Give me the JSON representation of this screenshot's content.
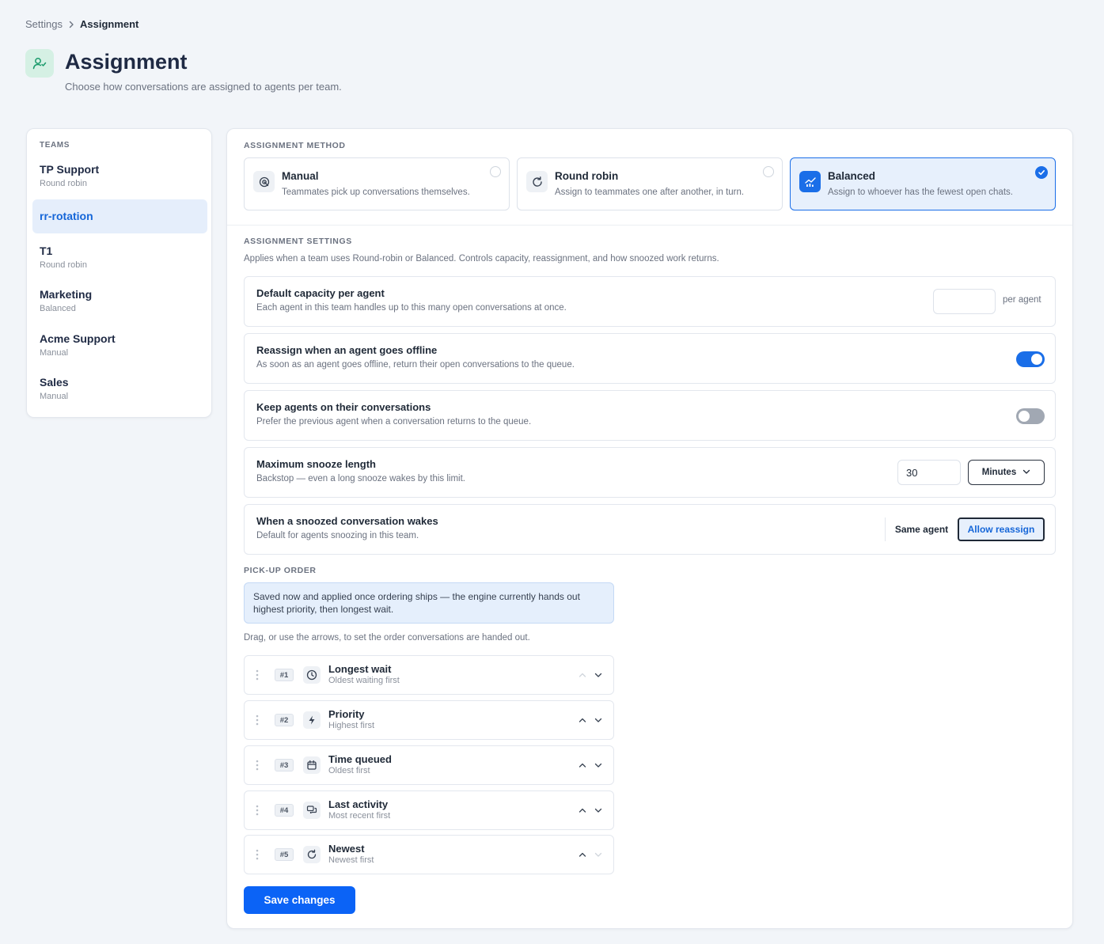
{
  "breadcrumb": {
    "parent": "Settings",
    "current": "Assignment"
  },
  "header": {
    "title": "Assignment",
    "subtitle": "Choose how conversations are assigned to agents per team."
  },
  "teams": {
    "heading": "TEAMS",
    "items": [
      {
        "name": "TP Support",
        "mode": "Round robin"
      },
      {
        "name": "rr-rotation",
        "mode": ""
      },
      {
        "name": "T1",
        "mode": "Round robin"
      },
      {
        "name": "Marketing",
        "mode": "Balanced"
      },
      {
        "name": "Acme Support",
        "mode": "Manual"
      },
      {
        "name": "Sales",
        "mode": "Manual"
      }
    ],
    "selected": "rr-rotation"
  },
  "method": {
    "heading": "ASSIGNMENT METHOD",
    "options": [
      {
        "title": "Manual",
        "desc": "Teammates pick up conversations themselves.",
        "icon": "hand-icon"
      },
      {
        "title": "Round robin",
        "desc": "Assign to teammates one after another, in turn.",
        "icon": "rotate-icon"
      },
      {
        "title": "Balanced",
        "desc": "Assign to whoever has the fewest open chats.",
        "icon": "chart-icon"
      }
    ],
    "selected": "Balanced"
  },
  "settings": {
    "heading": "ASSIGNMENT SETTINGS",
    "desc": "Applies when a team uses Round-robin or Balanced. Controls capacity, reassignment, and how snoozed work returns.",
    "capacity": {
      "title": "Default capacity per agent",
      "desc": "Each agent in this team handles up to this many open conversations at once.",
      "value": "",
      "unit": "per agent"
    },
    "reassign": {
      "title": "Reassign when an agent goes offline",
      "desc": "As soon as an agent goes offline, return their open conversations to the queue.",
      "on": true
    },
    "keep": {
      "title": "Keep agents on their conversations",
      "desc": "Prefer the previous agent when a conversation returns to the queue.",
      "on": false
    },
    "snooze": {
      "title": "Maximum snooze length",
      "desc": "Backstop — even a long snooze wakes by this limit.",
      "value": "30",
      "unit": "Minutes"
    },
    "wake": {
      "title": "When a snoozed conversation wakes",
      "desc": "Default for agents snoozing in this team.",
      "option_same": "Same agent",
      "option_allow": "Allow reassign",
      "selected": "Allow reassign"
    }
  },
  "pickup": {
    "heading": "PICK-UP ORDER",
    "note": "Saved now and applied once ordering ships — the engine currently hands out highest priority, then longest wait.",
    "desc": "Drag, or use the arrows, to set the order conversations are handed out.",
    "items": [
      {
        "rank": "#1",
        "title": "Longest wait",
        "desc": "Oldest waiting first",
        "icon": "clock-icon"
      },
      {
        "rank": "#2",
        "title": "Priority",
        "desc": "Highest first",
        "icon": "bolt-icon"
      },
      {
        "rank": "#3",
        "title": "Time queued",
        "desc": "Oldest first",
        "icon": "calendar-icon"
      },
      {
        "rank": "#4",
        "title": "Last activity",
        "desc": "Most recent first",
        "icon": "chat-icon"
      },
      {
        "rank": "#5",
        "title": "Newest",
        "desc": "Newest first",
        "icon": "refresh-icon"
      }
    ]
  },
  "save_label": "Save changes",
  "colors": {
    "accent": "#1a6ee8",
    "save": "#0b63f6",
    "selected_bg": "#e7f0fc",
    "header_icon_bg": "#d5f0e4"
  }
}
